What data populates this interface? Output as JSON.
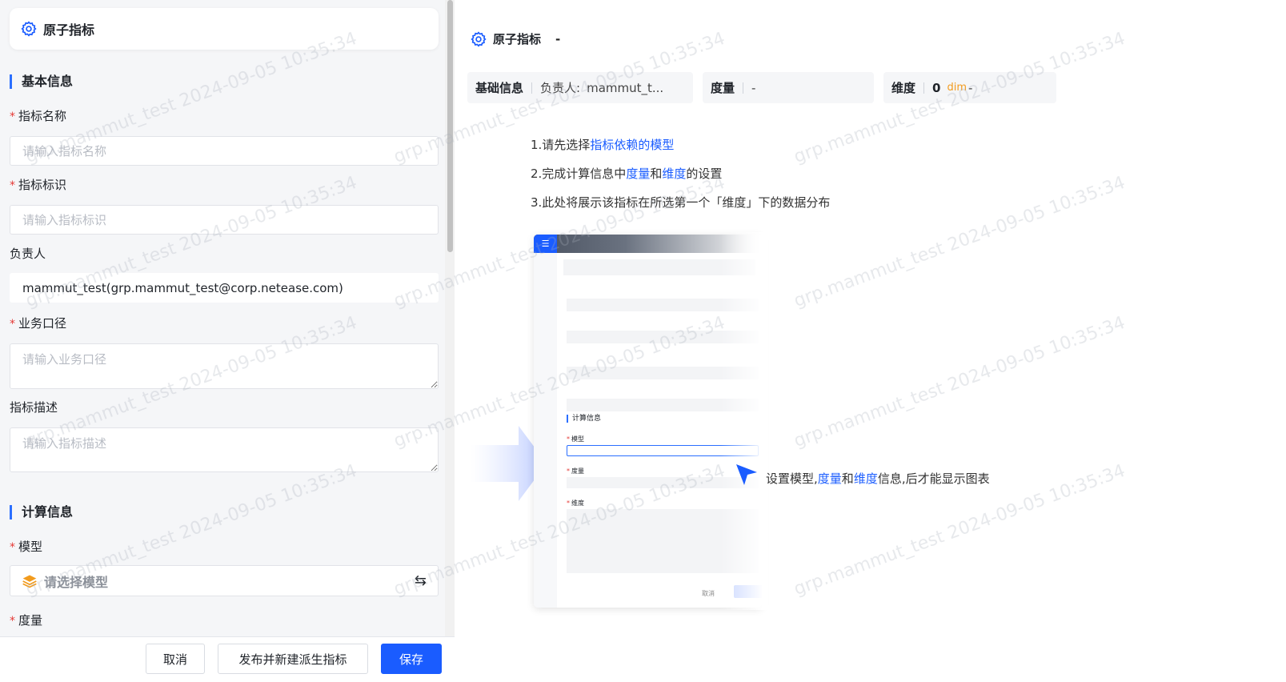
{
  "form": {
    "title": "原子指标",
    "basic_section": "基本信息",
    "metric_name": {
      "label": "指标名称",
      "required": "*",
      "placeholder": "请输入指标名称"
    },
    "metric_id": {
      "label": "指标标识",
      "required": "*",
      "placeholder": "请输入指标标识"
    },
    "owner": {
      "label": "负责人",
      "value": "mammut_test(grp.mammut_test@corp.netease.com)"
    },
    "business_scope": {
      "label": "业务口径",
      "required": "*",
      "placeholder": "请输入业务口径"
    },
    "description": {
      "label": "指标描述",
      "placeholder": "请输入指标描述"
    },
    "calc_section": "计算信息",
    "model": {
      "label": "模型",
      "required": "*",
      "placeholder": "请选择模型"
    },
    "measure": {
      "label": "度量",
      "required": "*"
    }
  },
  "footer": {
    "cancel": "取消",
    "publish": "发布并新建派生指标",
    "save": "保存"
  },
  "preview": {
    "title": "原子指标",
    "title_dash": "-",
    "basic": {
      "key": "基础信息",
      "owner_label": "负责人:",
      "owner_value": "mammut_t..."
    },
    "measure": {
      "key": "度量",
      "value": "-"
    },
    "dimension": {
      "key": "维度",
      "count": "0",
      "unit": "dim",
      "value": "-"
    },
    "steps": {
      "s1_pre": "1.请先选择",
      "s1_link": "指标依赖的模型",
      "s2_pre": "2.完成计算信息中",
      "s2_link1": "度量",
      "s2_mid": "和",
      "s2_link2": "维度",
      "s2_post": "的设置",
      "s3": "3.此处将展示该指标在所选第一个「维度」下的数据分布"
    },
    "mock": {
      "section": "计算信息",
      "model_label": "模型",
      "measure_label": "度量",
      "dim_label": "维度",
      "cancel": "取消",
      "req": "*"
    },
    "hint": {
      "pre": "设置模型,",
      "link1": "度量",
      "mid": "和",
      "link2": "维度",
      "post": "信息,后才能显示图表"
    }
  },
  "watermark": "grp.mammut_test 2024-09-05 10:35:34",
  "colors": {
    "primary": "#1a5cff",
    "required": "#e53935",
    "accent_orange": "#f29b1d"
  }
}
